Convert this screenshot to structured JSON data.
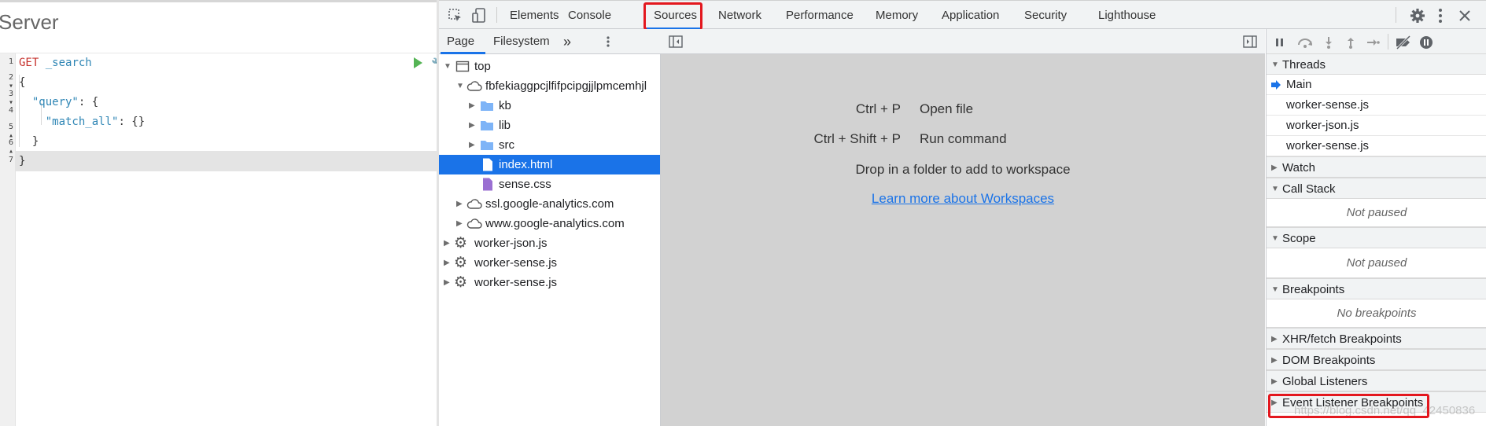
{
  "app": {
    "title": "Server",
    "editor": {
      "lines": [
        {
          "method": "GET",
          "path": " _search"
        },
        {
          "text": "{"
        },
        {
          "key": "\"query\"",
          "rest": ": {"
        },
        {
          "key": "\"match_all\"",
          "rest": ": {}"
        },
        {
          "text": "}"
        },
        {
          "text": "}"
        }
      ],
      "gutter_marks": [
        "1",
        "2 ▾",
        "3 ▾",
        "4",
        "5 ▴",
        "6 ▴",
        "7"
      ]
    }
  },
  "devtools": {
    "tabs": [
      {
        "label": "Elements"
      },
      {
        "label": "Console"
      },
      {
        "label": "Sources"
      },
      {
        "label": "Network"
      },
      {
        "label": "Performance"
      },
      {
        "label": "Memory"
      },
      {
        "label": "Application"
      },
      {
        "label": "Security"
      },
      {
        "label": "Lighthouse"
      }
    ],
    "navigator": {
      "tabs": [
        {
          "label": "Page"
        },
        {
          "label": "Filesystem"
        }
      ],
      "more": "»",
      "tree": [
        {
          "label": "top"
        },
        {
          "label": "fbfekiaggpcjlfifpcipgjjlpmcemhjl"
        },
        {
          "label": "kb"
        },
        {
          "label": "lib"
        },
        {
          "label": "src"
        },
        {
          "label": "index.html"
        },
        {
          "label": "sense.css"
        },
        {
          "label": "ssl.google-analytics.com"
        },
        {
          "label": "www.google-analytics.com"
        },
        {
          "label": "worker-json.js"
        },
        {
          "label": "worker-sense.js"
        },
        {
          "label": "worker-sense.js"
        }
      ]
    },
    "editor_placeholder": {
      "shortcuts": [
        {
          "keys": "Ctrl + P",
          "label": "Open file"
        },
        {
          "keys": "Ctrl + Shift + P",
          "label": "Run command"
        }
      ],
      "drop_hint": "Drop in a folder to add to workspace",
      "link": "Learn more about Workspaces"
    },
    "debugger": {
      "threads": {
        "title": "Threads",
        "items": [
          "Main",
          "worker-sense.js",
          "worker-json.js",
          "worker-sense.js"
        ]
      },
      "watch": "Watch",
      "call_stack": {
        "title": "Call Stack",
        "empty": "Not paused"
      },
      "scope": {
        "title": "Scope",
        "empty": "Not paused"
      },
      "breakpoints": {
        "title": "Breakpoints",
        "empty": "No breakpoints"
      },
      "xhr": "XHR/fetch Breakpoints",
      "dom": "DOM Breakpoints",
      "global": "Global Listeners",
      "event": "Event Listener Breakpoints"
    },
    "watermark": "https://blog.csdn.net/qq_42450836"
  },
  "colors": {
    "accent": "#1a73e8",
    "highlight_box": "#e3171e",
    "run_button": "#55b455",
    "folder": "#7eb4f7",
    "css_file": "#9a6fd2"
  }
}
